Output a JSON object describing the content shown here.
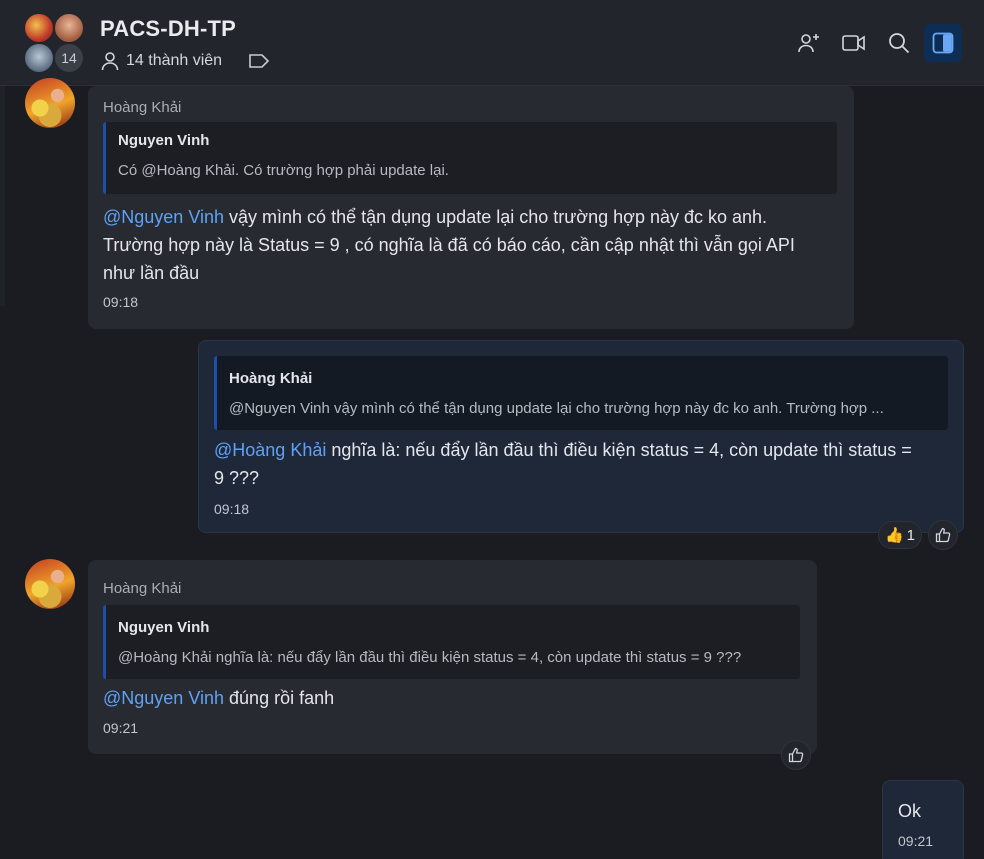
{
  "header": {
    "title": "PACS-DH-TP",
    "member_badge": "14",
    "members_label": "14 thành viên"
  },
  "messages": [
    {
      "sender": "Hoàng Khải",
      "quote_name": "Nguyen Vinh",
      "quote_text": "Có @Hoàng Khải. Có trường hợp phải update lại.",
      "mention": "@Nguyen Vinh",
      "text_line1": " vậy mình có thể tận dụng update lại cho trường hợp này đc ko anh.",
      "text_line2": "Trường hợp này là Status = 9 , có nghĩa là đã có báo cáo, cần cập nhật thì vẫn gọi API",
      "text_line3": "như lần đầu",
      "time": "09:18"
    },
    {
      "quote_name": "Hoàng Khải",
      "quote_text": "@Nguyen Vinh vậy mình có thể tận dụng update lại cho trường hợp này đc ko anh. Trường hợp ...",
      "mention": "@Hoàng Khải",
      "text_line1": " nghĩa là: nếu đẩy lần đầu thì điều kiện status = 4, còn update thì status =",
      "text_line2": "9 ???",
      "time": "09:18",
      "reaction_count": "1"
    },
    {
      "sender": "Hoàng Khải",
      "quote_name": "Nguyen Vinh",
      "quote_text": "@Hoàng Khải nghĩa là: nếu đẩy lần đầu thì điều kiện status = 4, còn update thì status = 9 ???",
      "mention": "@Nguyen Vinh",
      "text_line1": " đúng rồi fanh",
      "time": "09:21"
    },
    {
      "text_line1": "Ok",
      "time": "09:21"
    }
  ],
  "colors": {
    "mention": "#5ea2f5",
    "quote_bar": "#1b4fa8",
    "active_button": "#0d2d55"
  },
  "icons": [
    "add-member-icon",
    "video-call-icon",
    "search-icon",
    "sidebar-toggle-icon",
    "person-icon",
    "tag-icon",
    "thumbs-up-icon"
  ]
}
